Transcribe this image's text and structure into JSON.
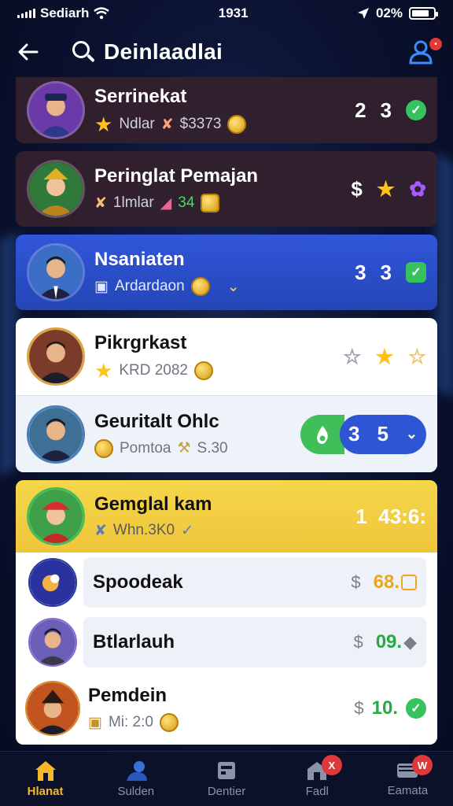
{
  "status_bar": {
    "carrier": "Sediarh",
    "time": "1931",
    "battery": "02%"
  },
  "header": {
    "title": "Deinlaadlai"
  },
  "players": [
    {
      "name": "Serrinekat",
      "meta_label": "Ndlar",
      "meta_value": "$3373",
      "score_a": "2",
      "score_b": "3"
    },
    {
      "name": "Peringlat Pemajan",
      "meta_label": "1lmlar",
      "meta_value": "34",
      "score_a": "$"
    },
    {
      "name": "Nsaniaten",
      "meta_label": "Ardardaon",
      "score_a": "3",
      "score_b": "3"
    },
    {
      "name": "Pikrgrkast",
      "meta_label": "KRD 2082"
    },
    {
      "name": "Geuritalt Ohlc",
      "meta_label": "Pomtoa",
      "meta_value": "S.30",
      "score_a": "3",
      "score_b": "5"
    },
    {
      "name": "Gemglal kam",
      "meta_label": "Whn.3K0",
      "score": "1  43:6:"
    },
    {
      "name": "Spoodeak",
      "currency": "$",
      "value": "68."
    },
    {
      "name": "Btlarlauh",
      "currency": "$",
      "value": "09."
    },
    {
      "name": "Pemdein",
      "meta_label": "Mi: 2:0",
      "currency": "$",
      "value": "10."
    }
  ],
  "nav": [
    {
      "label": "Hlanat",
      "icon": "home-icon"
    },
    {
      "label": "Sulden",
      "icon": "users-icon"
    },
    {
      "label": "Dentier",
      "icon": "store-icon"
    },
    {
      "label": "Fadl",
      "icon": "shop-icon",
      "badge": "X"
    },
    {
      "label": "Eamata",
      "icon": "mail-icon",
      "badge": "W"
    }
  ],
  "colors": {
    "accent_gold": "#f5b82a",
    "blue_card": "#2d55d4",
    "green": "#36c25c"
  }
}
